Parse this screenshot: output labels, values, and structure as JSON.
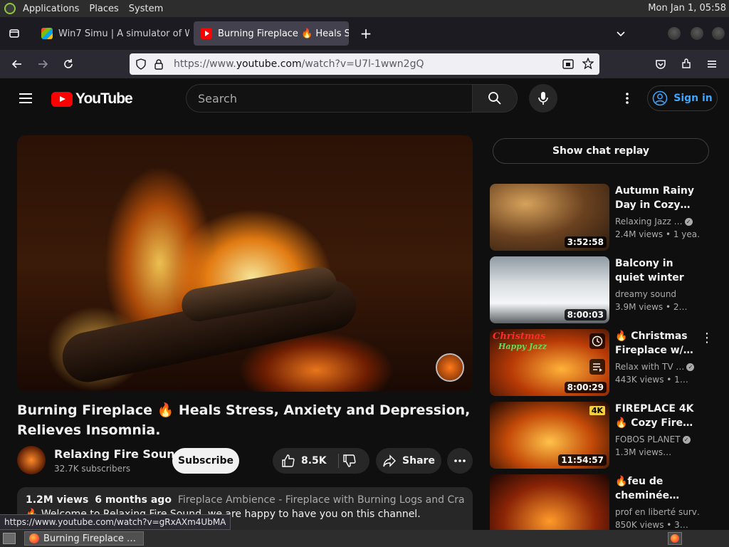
{
  "os_panel": {
    "menus": [
      "Applications",
      "Places",
      "System"
    ],
    "clock": "Mon Jan  1, 05:58"
  },
  "browser": {
    "tabs": [
      {
        "title": "Win7 Simu | A simulator of W",
        "favicon": "windows-icon",
        "active": false
      },
      {
        "title": "Burning Fireplace 🔥 Heals S",
        "favicon": "youtube-icon",
        "active": true
      }
    ],
    "new_tab": "+",
    "url_prefix": "https://www.",
    "url_domain": "youtube.com",
    "url_path": "/watch?v=U7l-1wwn2gQ"
  },
  "youtube": {
    "logo_text": "YouTube",
    "search_placeholder": "Search",
    "sign_in": "Sign in",
    "video": {
      "title": "Burning Fireplace 🔥 Heals Stress, Anxiety and Depression, Relieves Insomnia.",
      "channel": "Relaxing Fire Sound",
      "subscribers": "32.7K subscribers",
      "subscribe": "Subscribe",
      "likes": "8.5K",
      "share": "Share",
      "views": "1.2M views",
      "age": "6 months ago",
      "tags": "Fireplace Ambience - Fireplace with Burning Logs and Crackling Fire So",
      "desc_line": "🔥 Welcome to Relaxing Fire Sound, we are happy to have you on this channel."
    },
    "show_chat_replay": "Show chat replay",
    "recommendations": [
      {
        "title": "Autumn Rainy Day in Cozy…",
        "channel": "Relaxing Jazz …",
        "verified": true,
        "meta": "2.4M views  • 1 yea…",
        "duration": "3:52:58"
      },
      {
        "title": "Balcony in quiet winter mountain…",
        "channel": "dreamy sound",
        "verified": false,
        "meta": "3.9M views  • 2…",
        "duration": "8:00:03"
      },
      {
        "title": "🔥 Christmas Fireplace w/…",
        "channel": "Relax with TV …",
        "verified": true,
        "meta": "443K views  • 1…",
        "duration": "8:00:29",
        "thumb_text": "Christmas",
        "thumb_text2": "Happy Jazz"
      },
      {
        "title": "FIREPLACE 4K 🔥 Cozy Fire…",
        "channel": "FOBOS PLANET",
        "verified": true,
        "meta": "1.3M views…",
        "duration": "11:54:57",
        "badge": "4K"
      },
      {
        "title": "🔥feu de cheminée…",
        "channel": "prof en liberté surv…",
        "verified": false,
        "meta": "850K views  • 3…",
        "duration": ""
      }
    ]
  },
  "status_url": "https://www.youtube.com/watch?v=gRxAXm4UbMA",
  "taskbar": {
    "item": "Burning Fireplace …"
  }
}
